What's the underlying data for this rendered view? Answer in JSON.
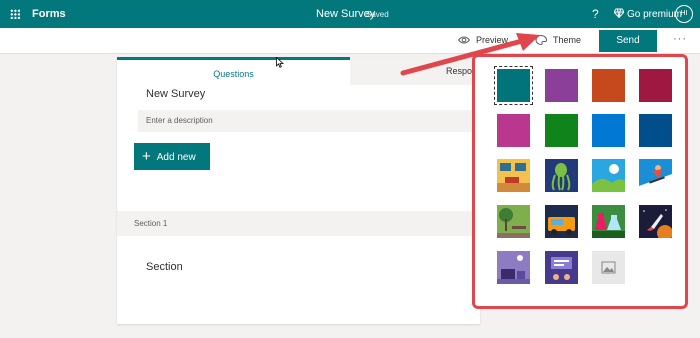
{
  "app": {
    "name": "Forms",
    "doc_title": "New Survey",
    "save_status": "Saved"
  },
  "topbar": {
    "help": "?",
    "premium": "Go premium",
    "avatar": "HI"
  },
  "cmdbar": {
    "preview": "Preview",
    "theme": "Theme",
    "send": "Send",
    "more": "···"
  },
  "tabs": {
    "questions": "Questions",
    "responses": "Respons"
  },
  "form": {
    "title": "New Survey",
    "description_placeholder": "Enter a description",
    "add_new": "Add new",
    "section_label": "Section 1",
    "section_title": "Section"
  },
  "themes": {
    "colors": [
      "#00747a",
      "#8c3f98",
      "#c5491c",
      "#9f1842",
      "#b9378f",
      "#10831a",
      "#0078d4",
      "#004e8c"
    ],
    "images": [
      "desk-scene",
      "octopus",
      "landscape-sun",
      "snowboarder",
      "forest-bench",
      "food-truck",
      "lab-flasks",
      "rocket-space",
      "purple-desk",
      "screen-chat",
      "custom-image"
    ]
  },
  "annotation": {
    "arrow_color": "#e0474c",
    "highlight_color": "#e0474c"
  }
}
